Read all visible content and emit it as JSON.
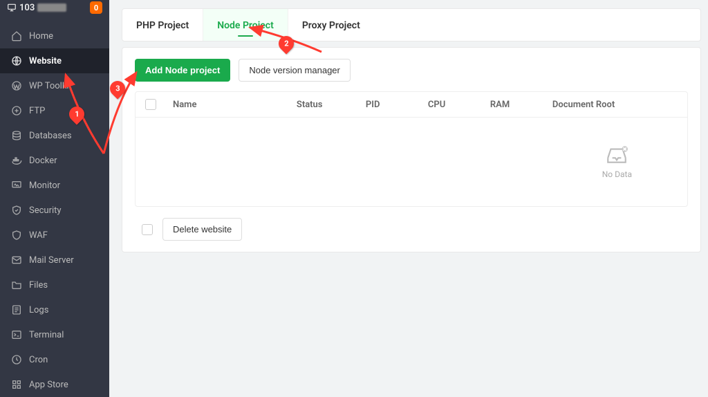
{
  "header": {
    "server_ip_prefix": "103",
    "badge_count": "0"
  },
  "sidebar": {
    "items": [
      {
        "key": "home",
        "label": "Home",
        "icon": "home"
      },
      {
        "key": "website",
        "label": "Website",
        "icon": "globe"
      },
      {
        "key": "wptoolkit",
        "label": "WP Toolkit",
        "icon": "wordpress"
      },
      {
        "key": "ftp",
        "label": "FTP",
        "icon": "ftp"
      },
      {
        "key": "databases",
        "label": "Databases",
        "icon": "database"
      },
      {
        "key": "docker",
        "label": "Docker",
        "icon": "docker"
      },
      {
        "key": "monitor",
        "label": "Monitor",
        "icon": "monitor"
      },
      {
        "key": "security",
        "label": "Security",
        "icon": "security"
      },
      {
        "key": "waf",
        "label": "WAF",
        "icon": "shield"
      },
      {
        "key": "mailserver",
        "label": "Mail Server",
        "icon": "mail"
      },
      {
        "key": "files",
        "label": "Files",
        "icon": "folder"
      },
      {
        "key": "logs",
        "label": "Logs",
        "icon": "logs"
      },
      {
        "key": "terminal",
        "label": "Terminal",
        "icon": "terminal"
      },
      {
        "key": "cron",
        "label": "Cron",
        "icon": "cron"
      },
      {
        "key": "appstore",
        "label": "App Store",
        "icon": "apps"
      }
    ],
    "active_key": "website"
  },
  "tabs": {
    "items": [
      {
        "key": "php",
        "label": "PHP Project"
      },
      {
        "key": "node",
        "label": "Node Project"
      },
      {
        "key": "proxy",
        "label": "Proxy Project"
      }
    ],
    "active_key": "node"
  },
  "toolbar": {
    "add_label": "Add Node project",
    "version_label": "Node version manager"
  },
  "table": {
    "columns": {
      "name": "Name",
      "status": "Status",
      "pid": "PID",
      "cpu": "CPU",
      "ram": "RAM",
      "root": "Document Root"
    },
    "empty_text": "No Data"
  },
  "footer": {
    "delete_label": "Delete website"
  },
  "annotations": {
    "step1": "1",
    "step2": "2",
    "step3": "3"
  }
}
